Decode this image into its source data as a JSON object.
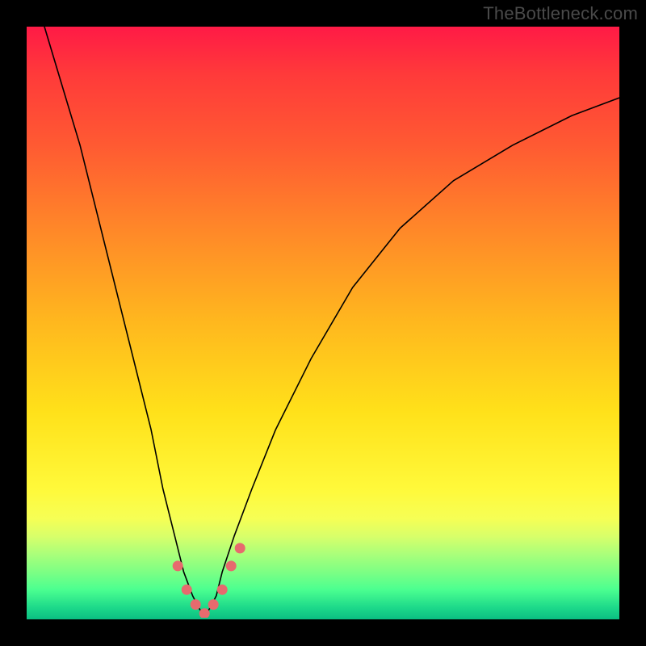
{
  "watermark": "TheBottleneck.com",
  "colors": {
    "background": "#000000",
    "gradient_top": "#ff1a46",
    "gradient_bottom": "#0bbf82",
    "curve_stroke": "#000000",
    "marker_fill": "#e76a6e"
  },
  "chart_data": {
    "type": "line",
    "title": "",
    "xlabel": "",
    "ylabel": "",
    "xlim": [
      0,
      100
    ],
    "ylim": [
      0,
      100
    ],
    "x": [
      3,
      6,
      9,
      12,
      15,
      18,
      21,
      23,
      25,
      26.5,
      28,
      29,
      30,
      31,
      32,
      33,
      35,
      38,
      42,
      48,
      55,
      63,
      72,
      82,
      92,
      100
    ],
    "values": [
      100,
      90,
      80,
      68,
      56,
      44,
      32,
      22,
      14,
      8,
      4,
      2,
      0.5,
      2,
      4,
      8,
      14,
      22,
      32,
      44,
      56,
      66,
      74,
      80,
      85,
      88
    ],
    "markers_x": [
      25.5,
      27,
      28.5,
      30,
      31.5,
      33,
      34.5,
      36
    ],
    "markers_y": [
      9,
      5,
      2.5,
      1,
      2.5,
      5,
      9,
      12
    ],
    "notes": "V-shaped bottleneck curve with minimum near x≈30; background is a red→green vertical gradient; pink dot markers cluster around the trough."
  }
}
